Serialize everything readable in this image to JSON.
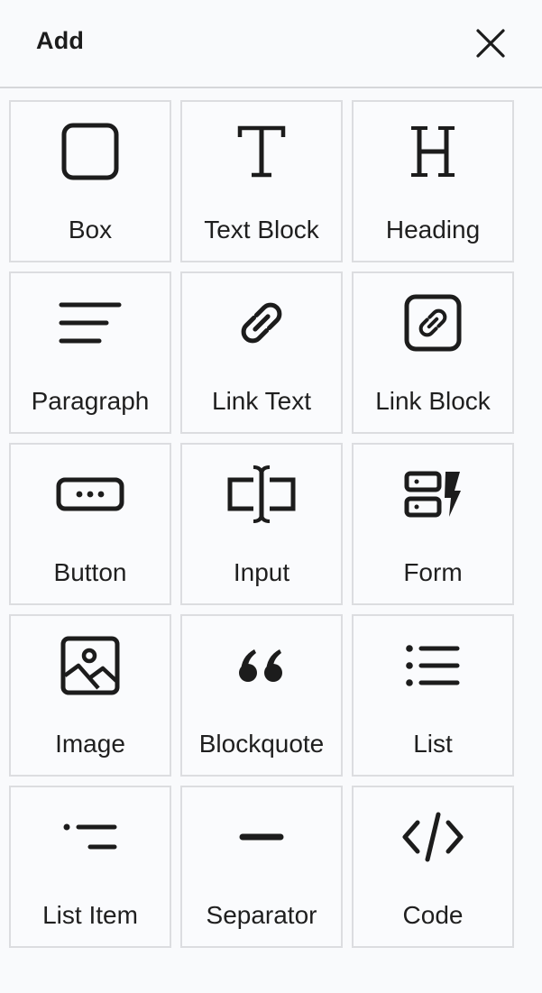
{
  "header": {
    "title": "Add",
    "close_icon": "close-icon"
  },
  "blocks": [
    {
      "label": "Box",
      "icon": "box-icon"
    },
    {
      "label": "Text Block",
      "icon": "text-block-icon"
    },
    {
      "label": "Heading",
      "icon": "heading-icon"
    },
    {
      "label": "Paragraph",
      "icon": "paragraph-icon"
    },
    {
      "label": "Link Text",
      "icon": "link-icon"
    },
    {
      "label": "Link Block",
      "icon": "link-block-icon"
    },
    {
      "label": "Button",
      "icon": "button-icon"
    },
    {
      "label": "Input",
      "icon": "input-icon"
    },
    {
      "label": "Form",
      "icon": "form-icon"
    },
    {
      "label": "Image",
      "icon": "image-icon"
    },
    {
      "label": "Blockquote",
      "icon": "blockquote-icon"
    },
    {
      "label": "List",
      "icon": "list-icon"
    },
    {
      "label": "List Item",
      "icon": "list-item-icon"
    },
    {
      "label": "Separator",
      "icon": "separator-icon"
    },
    {
      "label": "Code",
      "icon": "code-icon"
    }
  ]
}
